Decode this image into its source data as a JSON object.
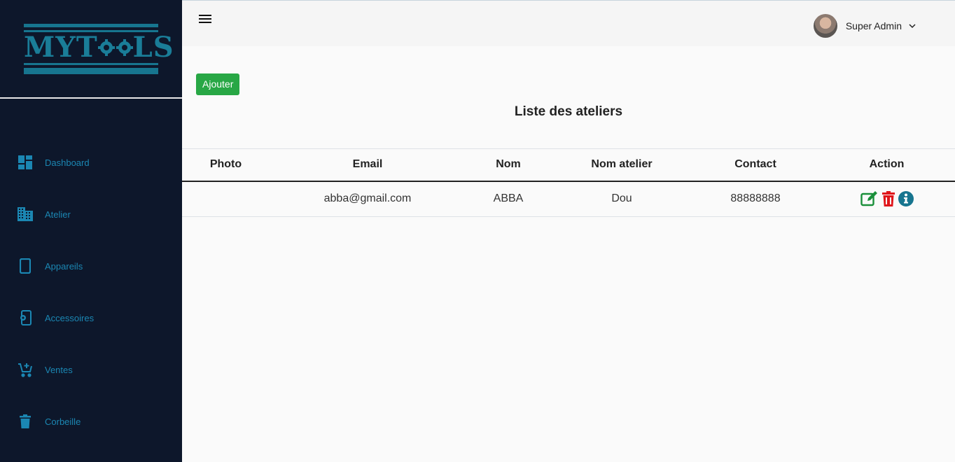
{
  "app": {
    "logo_text": "MYTOOLS"
  },
  "sidebar": {
    "items": [
      {
        "label": "Dashboard",
        "icon": "dashboard-icon"
      },
      {
        "label": "Atelier",
        "icon": "building-icon"
      },
      {
        "label": "Appareils",
        "icon": "phone-icon"
      },
      {
        "label": "Accessoires",
        "icon": "phone-settings-icon"
      },
      {
        "label": "Ventes",
        "icon": "cart-add-icon"
      },
      {
        "label": "Corbeille",
        "icon": "trash-icon"
      }
    ]
  },
  "header": {
    "user_name": "Super Admin"
  },
  "main": {
    "add_button": "Ajouter",
    "title": "Liste des ateliers",
    "table": {
      "columns": [
        "Photo",
        "Email",
        "Nom",
        "Nom atelier",
        "Contact",
        "Action"
      ],
      "rows": [
        {
          "photo": "",
          "email": "abba@gmail.com",
          "nom": "ABBA",
          "nom_atelier": "Dou",
          "contact": "88888888"
        }
      ]
    }
  },
  "colors": {
    "sidebar_bg": "#0d172b",
    "nav_text": "#1b87b3",
    "add_button": "#28a745",
    "edit": "#1a8f3a",
    "delete": "#e0161b",
    "info": "#17758f"
  }
}
